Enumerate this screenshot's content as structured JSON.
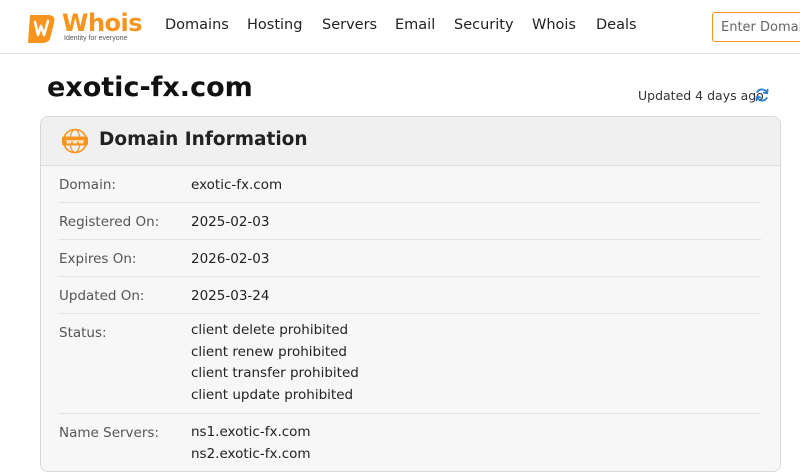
{
  "brand": {
    "name": "Whois",
    "tagline": "Identity for everyone",
    "accent_color": "#f7941d"
  },
  "nav": {
    "items": [
      "Domains",
      "Hosting",
      "Servers",
      "Email",
      "Security",
      "Whois",
      "Deals"
    ]
  },
  "search": {
    "placeholder": "Enter Domain"
  },
  "page": {
    "title": "exotic-fx.com",
    "updated_text": "Updated 4 days ago",
    "refresh_icon": "refresh-icon"
  },
  "card": {
    "title": "Domain Information",
    "icon": "www-icon",
    "rows": [
      {
        "label": "Domain:",
        "values": [
          "exotic-fx.com"
        ]
      },
      {
        "label": "Registered On:",
        "values": [
          "2025-02-03"
        ]
      },
      {
        "label": "Expires On:",
        "values": [
          "2026-02-03"
        ]
      },
      {
        "label": "Updated On:",
        "values": [
          "2025-03-24"
        ]
      },
      {
        "label": "Status:",
        "values": [
          "client delete prohibited",
          "client renew prohibited",
          "client transfer prohibited",
          "client update prohibited"
        ]
      },
      {
        "label": "Name Servers:",
        "values": [
          "ns1.exotic-fx.com",
          "ns2.exotic-fx.com"
        ]
      }
    ]
  }
}
